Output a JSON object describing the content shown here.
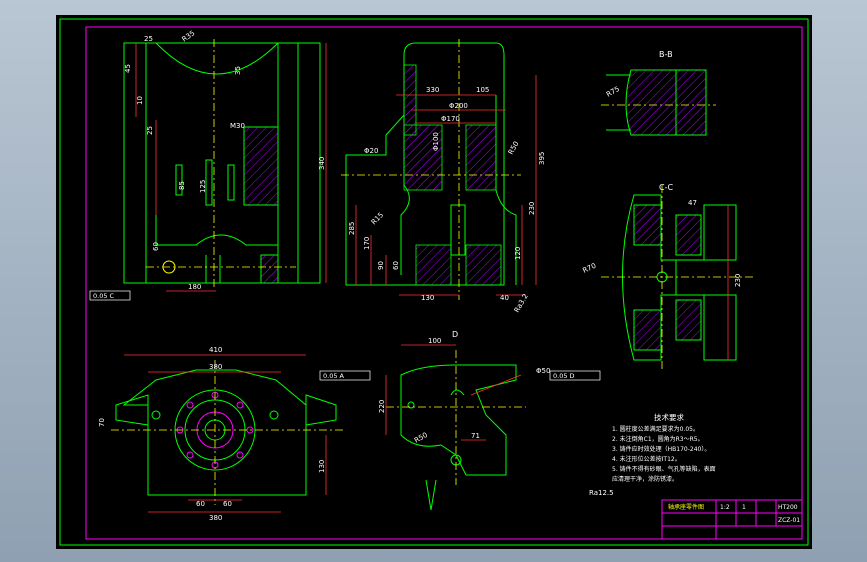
{
  "colors": {
    "background": "#000000",
    "border": "#00ff00",
    "inner_frame": "#ff00ff",
    "outline": "#00ff00",
    "dimension": "#ff3030",
    "center_line": "#ffff00",
    "hatch": "#b000ff",
    "text": "#ffffff"
  },
  "views": {
    "section_bb_label": "B-B",
    "section_cc_label": "C-C",
    "view_d_label": "D"
  },
  "dimensions": {
    "top_left_25": "25",
    "top_left_r35": "R35",
    "left_45": "45",
    "left_10": "10",
    "left_25": "25",
    "left_35": "35",
    "left_85": "85",
    "left_125": "125",
    "left_60": "60",
    "left_180": "180",
    "left_340": "340",
    "m30": "M30",
    "mid_330": "330",
    "mid_105": "105",
    "mid_phi200": "Φ200",
    "mid_phi170": "Φ170",
    "mid_phi100": "Φ100",
    "mid_phi20": "Φ20",
    "mid_285": "285",
    "mid_170": "170",
    "mid_90": "90",
    "mid_60": "60",
    "mid_130": "130",
    "mid_120": "120",
    "mid_40": "40",
    "mid_230": "230",
    "mid_395": "395",
    "mid_r50": "R50",
    "mid_r15": "R15",
    "mid_ra32": "Ra3.2",
    "right_r75": "R75",
    "right_r70": "R70",
    "right_230": "230",
    "right_47": "47",
    "bottom_410": "410",
    "bottom_380_top": "380",
    "bottom_380": "380",
    "bottom_70": "70",
    "bottom_130": "130",
    "bottom_60a": "60",
    "bottom_60b": "60",
    "bottom_100": "100",
    "bottom_220": "220",
    "bottom_71": "71",
    "bottom_r50": "R50",
    "phi50": "Φ50",
    "ra125": "Ra12.5"
  },
  "tolerance_frames": {
    "left": "0.05 C",
    "bottom_left": "0.05 A",
    "bottom_mid": "0.05 D"
  },
  "tech_requirements": {
    "title": "技术要求",
    "items": [
      "1. 圆柱度公差满足要求为0.05。",
      "2. 未注倒角C1，圆角为R3～R5。",
      "3. 铸件应时效处理（HB170-240）。",
      "4. 未注形位公差按IT12。",
      "5. 铸件不得有砂眼、气孔等缺陷，表面",
      "    应清理干净，涂防锈漆。"
    ]
  },
  "title_block": {
    "part_name": "轴承座零件图",
    "scale": "1:2",
    "quantity": "1",
    "material": "HT200",
    "drawing_no": "ZCZ-01"
  }
}
